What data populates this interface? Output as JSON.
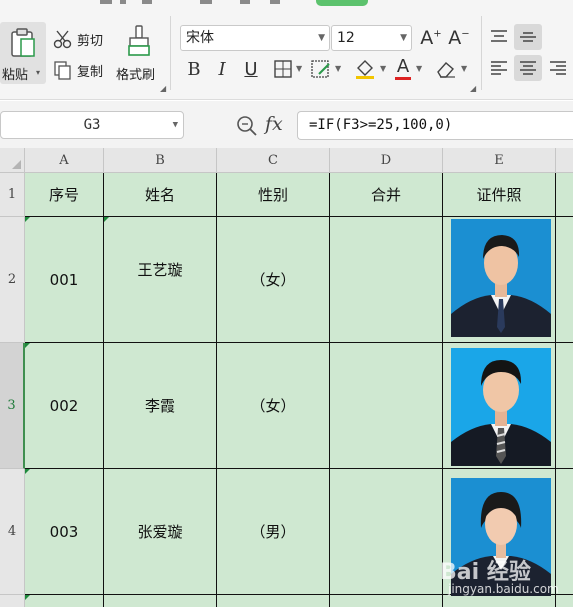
{
  "ribbon": {
    "paste_label": "粘贴",
    "cut_label": "剪切",
    "copy_label": "复制",
    "format_painter_label": "格式刷",
    "font_name": "宋体",
    "font_size": "12",
    "grow_font_icon": "A⁺",
    "shrink_font_icon": "A⁻",
    "bold": "B",
    "italic": "I",
    "underline": "U",
    "font_color_letter": "A"
  },
  "formula_bar": {
    "name_box": "G3",
    "fx_label": "fx",
    "formula": "=IF(F3>=25,100,0)"
  },
  "sheet": {
    "columns": [
      "A",
      "B",
      "C",
      "D",
      "E"
    ],
    "header_row": {
      "row": "1",
      "cells": [
        "序号",
        "姓名",
        "性别",
        "合并",
        "证件照"
      ]
    },
    "rows": [
      {
        "row": "2",
        "id": "001",
        "name": "王艺璇",
        "gender": "（女）",
        "merge": ""
      },
      {
        "row": "3",
        "id": "002",
        "name": "李霞",
        "gender": "（女）",
        "merge": ""
      },
      {
        "row": "4",
        "id": "003",
        "name": "张爱璇",
        "gender": "（男）",
        "merge": ""
      }
    ],
    "active_row": "3",
    "cell_fill_color": "#cfe8d1",
    "photo_background_color": "#1b8fd2"
  },
  "watermark": {
    "text": "Bai 经验",
    "subtext": "jingyan.baidu.com"
  }
}
